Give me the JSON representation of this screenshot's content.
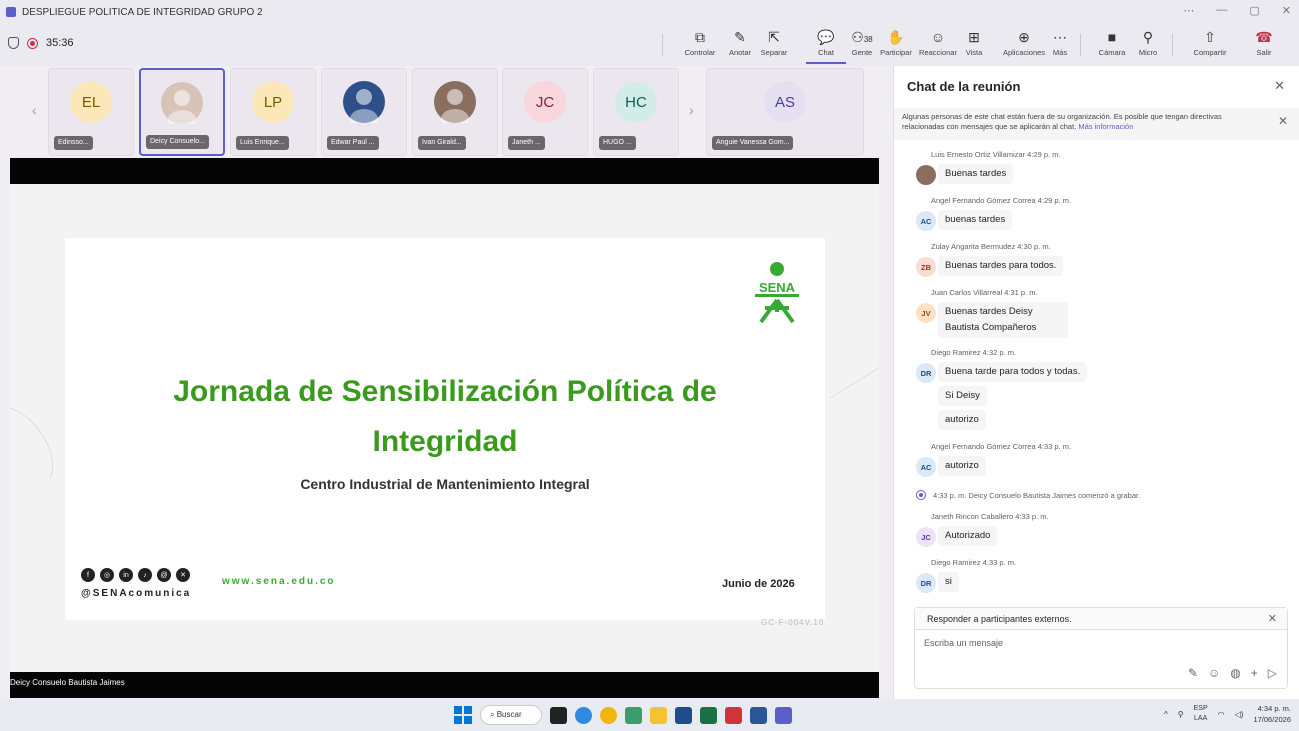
{
  "window": {
    "title": "DESPLIEGUE POLITICA DE INTEGRIDAD GRUPO 2",
    "controls": [
      "⋯",
      "—",
      "▢",
      "✕"
    ]
  },
  "toolbar": {
    "timer": "35:36",
    "buttons": [
      {
        "label": "Controlar",
        "icon": "control-icon"
      },
      {
        "label": "Anotar",
        "icon": "pen-icon"
      },
      {
        "label": "Separar",
        "icon": "popout-icon"
      },
      {
        "label": "Chat",
        "icon": "chat-icon"
      },
      {
        "label": "Gente",
        "icon": "people-icon",
        "count": "38"
      },
      {
        "label": "Participar",
        "icon": "raise-hand-icon"
      },
      {
        "label": "Reaccionar",
        "icon": "emoji-icon"
      },
      {
        "label": "Vista",
        "icon": "view-icon"
      },
      {
        "label": "Aplicaciones",
        "icon": "apps-icon"
      },
      {
        "label": "Más",
        "icon": "more-icon"
      },
      {
        "label": "Cámara",
        "icon": "camera-off-icon"
      },
      {
        "label": "Micro",
        "icon": "mic-off-icon"
      },
      {
        "label": "Compartir",
        "icon": "share-icon"
      },
      {
        "label": "Salir",
        "icon": "leave-icon"
      }
    ]
  },
  "participants": [
    {
      "initials": "EL",
      "name": "Edinsso...",
      "color": "#fbe7b7",
      "fg": "#7a5a00"
    },
    {
      "initials": "",
      "name": "Deicy Consuelo...",
      "color": "#d8c3b8",
      "fg": "#333",
      "photo": true
    },
    {
      "initials": "LP",
      "name": "Luis Enrique...",
      "color": "#fbe7b7",
      "fg": "#7a5a00"
    },
    {
      "initials": "",
      "name": "Edwar Paul ...",
      "color": "#2d4f8a",
      "fg": "#fff",
      "photo": true
    },
    {
      "initials": "",
      "name": "Ivan Girald...",
      "color": "#8a6f5f",
      "fg": "#fff",
      "photo": true
    },
    {
      "initials": "JC",
      "name": "Janeth ...",
      "color": "#f7d6dc",
      "fg": "#8a1f3c"
    },
    {
      "initials": "HC",
      "name": "HUGO ...",
      "color": "#d2ece8",
      "fg": "#0e5d55"
    },
    {
      "initials": "AS",
      "name": "Anguie Vanessa Gom...",
      "color": "#e4e0f2",
      "fg": "#4a3f8a"
    }
  ],
  "slide": {
    "title_line1": "Jornada de Sensibilización Política de",
    "title_line2": "Integridad",
    "subtitle": "Centro Industrial de Mantenimiento Integral",
    "logo_text": "SENA",
    "social_handle": "@SENAcomunica",
    "website": "www.sena.edu.co",
    "date": "Junio de 2026",
    "code": "GC-F-004V.10",
    "presenter": "Deicy Consuelo Bautista Jaimes"
  },
  "chat": {
    "title": "Chat de la reunión",
    "banner_text": "Algunas personas de este chat están fuera de su organización. Es posible que tengan directivas relacionadas con mensajes que se aplicarán al chat.",
    "banner_link": "Más información",
    "messages": [
      {
        "meta": "Luis Ernesto Ortiz Villamizar  4:29 p. m.",
        "avatar": "",
        "photo": true,
        "bubbles": [
          "Buenas tardes"
        ]
      },
      {
        "meta": "Angel Fernando Gómez Correa  4:29 p. m.",
        "avatar": "AC",
        "bubbles": [
          "buenas tardes"
        ]
      },
      {
        "meta": "Zulay Angarita Bermudez  4:30 p. m.",
        "avatar": "ZB",
        "bubbles": [
          "Buenas tardes  para todos."
        ]
      },
      {
        "meta": "Juan Carlos Villarreal  4:31 p. m.",
        "avatar": "JV",
        "bubbles": [
          "Buenas tardes Deisy Bautista Compañeros"
        ]
      },
      {
        "meta": "Diego Ramirez  4:32 p. m.",
        "avatar": "DR",
        "bubbles": [
          "Buena tarde para todos y todas.",
          "Si Deisy",
          "autorizo"
        ]
      },
      {
        "meta": "Angel Fernando Gómez Correa  4:33 p. m.",
        "avatar": "AC",
        "bubbles": [
          "autorizo"
        ]
      },
      {
        "system": "4:33 p. m.   Deicy Consuelo Bautista Jaimes comenzó a grabar."
      },
      {
        "meta": "Janeth Rincon Caballero  4:33 p. m.",
        "avatar": "JC",
        "bubbles": [
          "Autorizado"
        ]
      },
      {
        "meta": "Diego Ramirez  4:33 p. m.",
        "avatar": "DR",
        "bubbles": [
          "si"
        ]
      }
    ],
    "reply_label": "Responder a participantes externos.",
    "input_placeholder": "Escriba un mensaje"
  },
  "taskbar": {
    "search_label": "Buscar",
    "lang": "ESP",
    "lang2": "LAA",
    "time": "4:34 p. m.",
    "date": "17/06/2026"
  }
}
